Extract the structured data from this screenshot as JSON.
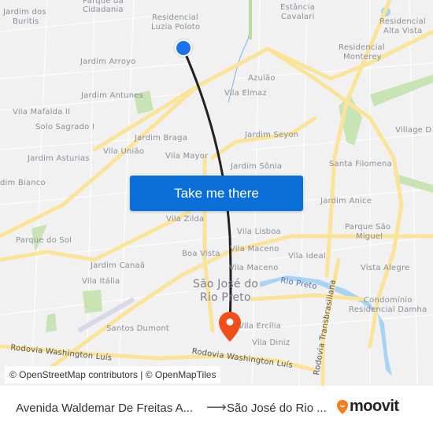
{
  "map": {
    "labels": [
      {
        "text": "Parque da",
        "name": "label-parque-da-cidadania-1"
      },
      {
        "text": "Cidadania",
        "name": "label-parque-da-cidadania-2"
      },
      {
        "text": "Jardim dos",
        "name": "label-jardim-dos-buritis-1"
      },
      {
        "text": "Buritis",
        "name": "label-jardim-dos-buritis-2"
      },
      {
        "text": "Residencial",
        "name": "label-residencial-luzia-poloto-1"
      },
      {
        "text": "Luzia Poloto",
        "name": "label-residencial-luzia-poloto-2"
      },
      {
        "text": "Estância",
        "name": "label-estancia-cavalari-1"
      },
      {
        "text": "Cavalari",
        "name": "label-estancia-cavalari-2"
      },
      {
        "text": "Residencial",
        "name": "label-residencial-alta-vista-1"
      },
      {
        "text": "Alta Vista",
        "name": "label-residencial-alta-vista-2"
      },
      {
        "text": "Residencial",
        "name": "label-residencial-monterey-1"
      },
      {
        "text": "Monterey",
        "name": "label-residencial-monterey-2"
      },
      {
        "text": "Jardim Arroyo",
        "name": "label-jardim-arroyo"
      },
      {
        "text": "Azulão",
        "name": "label-azulao"
      },
      {
        "text": "Vila Elmaz",
        "name": "label-vila-elmaz"
      },
      {
        "text": "Jardim Antunes",
        "name": "label-jardim-antunes"
      },
      {
        "text": "Vila Mafalda II",
        "name": "label-vila-mafalda-ii"
      },
      {
        "text": "Solo Sagrado I",
        "name": "label-solo-sagrado-i"
      },
      {
        "text": "Jardim Braga",
        "name": "label-jardim-braga"
      },
      {
        "text": "Vila União",
        "name": "label-vila-uniao"
      },
      {
        "text": "Vila Mayor",
        "name": "label-vila-mayor"
      },
      {
        "text": "Jardim Seyon",
        "name": "label-jardim-seyon"
      },
      {
        "text": "Village D",
        "name": "label-village-d"
      },
      {
        "text": "Jardim Asturias",
        "name": "label-jardim-asturias"
      },
      {
        "text": "Jardim Sônia",
        "name": "label-jardim-sonia"
      },
      {
        "text": "Santa Filomena",
        "name": "label-santa-filomena"
      },
      {
        "text": "dim Bianco",
        "name": "label-jardim-bianco"
      },
      {
        "text": "Jardim Anice",
        "name": "label-jardim-anice"
      },
      {
        "text": "Vila Zilda",
        "name": "label-vila-zilda"
      },
      {
        "text": "Vila Lisboa",
        "name": "label-vila-lisboa"
      },
      {
        "text": "Parque São",
        "name": "label-parque-sao-miguel-1"
      },
      {
        "text": "Miguel",
        "name": "label-parque-sao-miguel-2"
      },
      {
        "text": "Parque do Sol",
        "name": "label-parque-do-sol"
      },
      {
        "text": "Boa Vista",
        "name": "label-boa-vista"
      },
      {
        "text": "Vila Maceno",
        "name": "label-vila-maceno-1"
      },
      {
        "text": "Vila Ideal",
        "name": "label-vila-ideal"
      },
      {
        "text": "Jardim Canaã",
        "name": "label-jardim-canaa"
      },
      {
        "text": "Vila Maceno",
        "name": "label-vila-maceno-2"
      },
      {
        "text": "Vista Alegre",
        "name": "label-vista-alegre"
      },
      {
        "text": "Vila Itália",
        "name": "label-vila-italia"
      },
      {
        "text": "São José do",
        "name": "label-sao-jose-do-rio-preto-1"
      },
      {
        "text": "Rio Preto",
        "name": "label-sao-jose-do-rio-preto-2"
      },
      {
        "text": "Rio Preto",
        "name": "label-rio-preto-river"
      },
      {
        "text": "Condomínio",
        "name": "label-condominio-residencial-damha-1"
      },
      {
        "text": "Residencial Damha",
        "name": "label-condominio-residencial-damha-2"
      },
      {
        "text": "Santos Dumont",
        "name": "label-santos-dumont"
      },
      {
        "text": "Vila Ercília",
        "name": "label-vila-ercilia"
      },
      {
        "text": "Vila Diniz",
        "name": "label-vila-diniz"
      },
      {
        "text": "Rodovia Washington Luís",
        "name": "label-rodovia-washington-luis-west"
      },
      {
        "text": "Rodovia Washington Luís",
        "name": "label-rodovia-washington-luis-east"
      },
      {
        "text": "Rodovia Transbrasiliana",
        "name": "label-rodovia-transbrasiliana"
      }
    ],
    "cta_label": "Take me there",
    "attribution": "© OpenStreetMap contributors | © OpenMapTiles",
    "colors": {
      "route": "#222222",
      "origin": "#1a73e8",
      "destination": "#f04e1a",
      "cta": "#0a6fd8",
      "road": "#fbe49a",
      "park": "#c9e4b4",
      "water": "#a9d3f2"
    }
  },
  "footer": {
    "origin": "Avenida Waldemar De Freitas A...",
    "arrow": "⟶",
    "destination": "São José do Rio ...",
    "brand": "moovit"
  }
}
